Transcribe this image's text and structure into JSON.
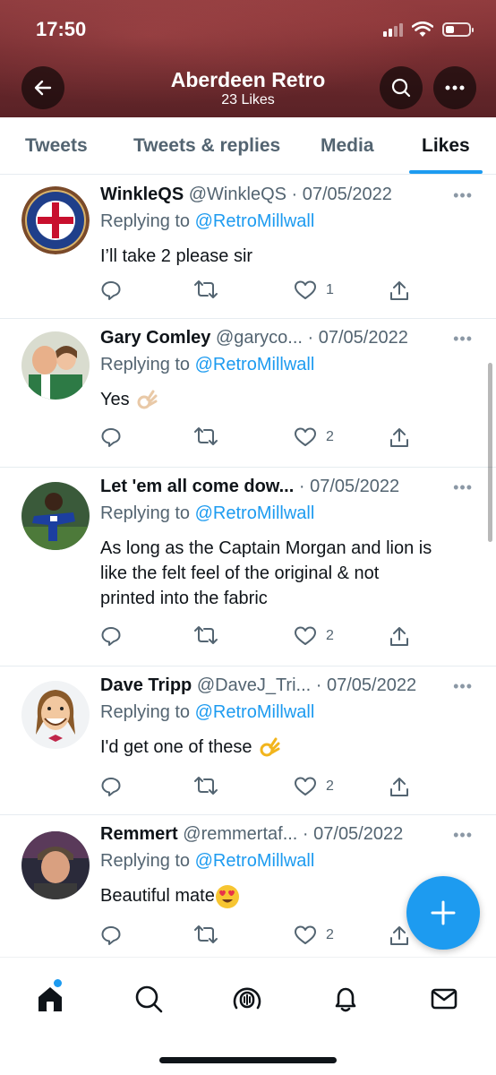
{
  "status": {
    "time": "17:50"
  },
  "header": {
    "title": "Aberdeen Retro",
    "subtitle": "23 Likes"
  },
  "tabs": [
    {
      "label": "Tweets",
      "active": false
    },
    {
      "label": "Tweets & replies",
      "active": false
    },
    {
      "label": "Media",
      "active": false
    },
    {
      "label": "Likes",
      "active": true
    }
  ],
  "tweets": [
    {
      "name": "WinkleQS",
      "meta": "@WinkleQS · 07/05/2022",
      "replying_prefix": "Replying to ",
      "replying_to": "@RetroMillwall",
      "lines": [
        "I’ll take 2 please sir"
      ],
      "like_count": "1",
      "emoji": ""
    },
    {
      "name": "Gary Comley",
      "meta": "@garyco... · 07/05/2022",
      "replying_prefix": "Replying to ",
      "replying_to": "@RetroMillwall",
      "lines": [
        "Yes"
      ],
      "like_count": "2",
      "emoji": "ok-hand"
    },
    {
      "name": "Let 'em all come dow...",
      "meta": "· 07/05/2022",
      "replying_prefix": "Replying to ",
      "replying_to": "@RetroMillwall",
      "lines": [
        "As long as the Captain Morgan and lion is",
        "like the felt feel of the original & not",
        "printed into the fabric"
      ],
      "like_count": "2",
      "emoji": ""
    },
    {
      "name": "Dave Tripp",
      "meta": "@DaveJ_Tri... · 07/05/2022",
      "replying_prefix": "Replying to ",
      "replying_to": "@RetroMillwall",
      "lines": [
        "I'd get one of these"
      ],
      "like_count": "2",
      "emoji": "ok-hand"
    },
    {
      "name": "Remmert",
      "meta": "@remmertaf... · 07/05/2022",
      "replying_prefix": "Replying to ",
      "replying_to": "@RetroMillwall",
      "lines": [
        "Beautiful mate"
      ],
      "like_count": "2",
      "emoji": "heart-eyes"
    }
  ],
  "colors": {
    "accent": "#1d9bf0",
    "text": "#0f1419",
    "muted": "#536471",
    "header_bg": "#6e2a2e"
  },
  "nav": [
    {
      "icon": "home-icon"
    },
    {
      "icon": "search-icon"
    },
    {
      "icon": "spaces-icon"
    },
    {
      "icon": "notifications-icon"
    },
    {
      "icon": "messages-icon"
    }
  ]
}
